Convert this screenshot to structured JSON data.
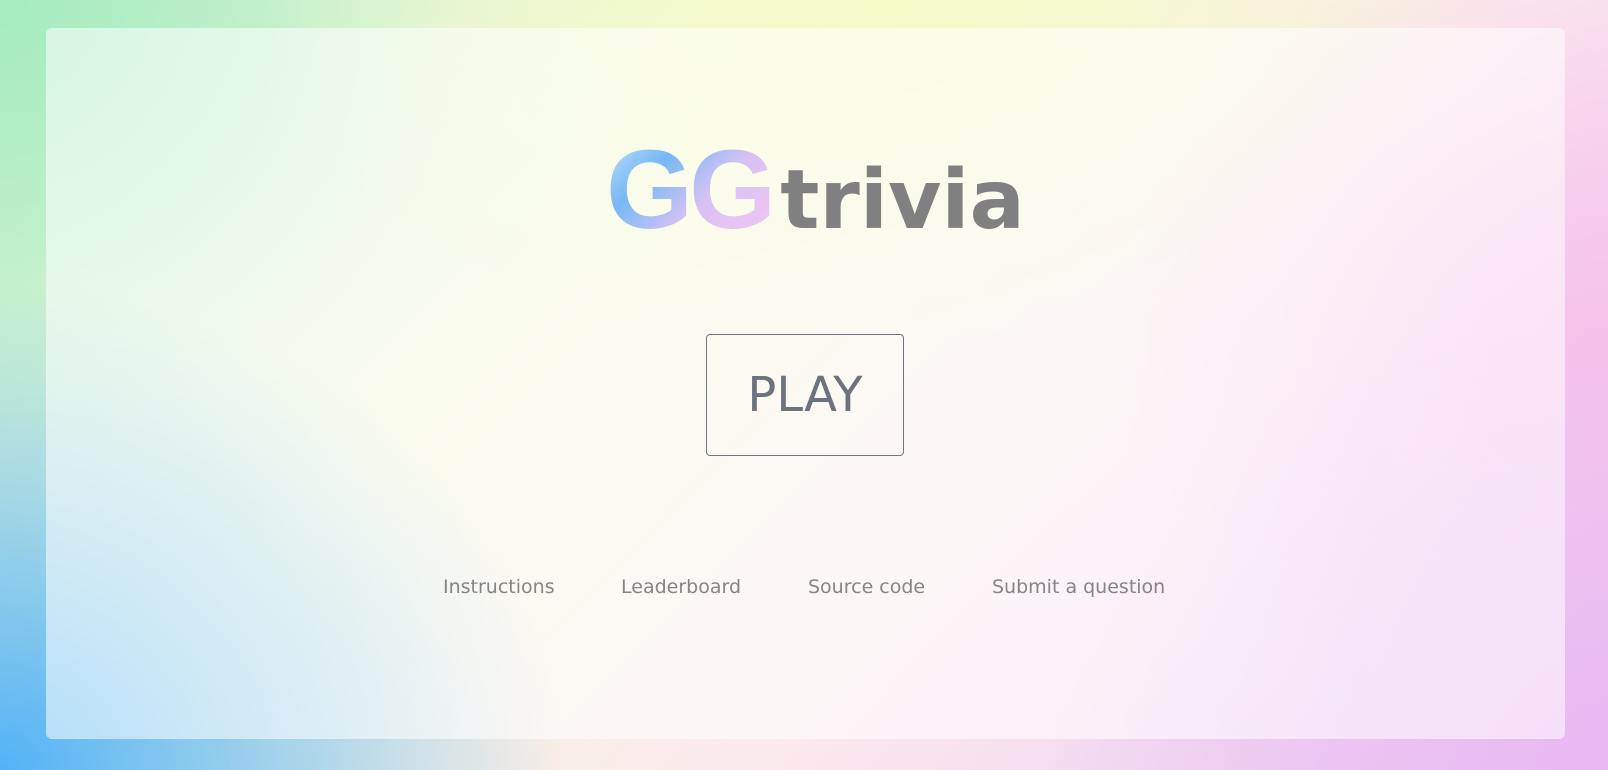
{
  "logo": {
    "gg_text": "GG",
    "trivia_text": "trivia"
  },
  "play_label": "PLAY",
  "nav": {
    "instructions": "Instructions",
    "leaderboard": "Leaderboard",
    "source_code": "Source code",
    "submit_question": "Submit a question"
  },
  "colors": {
    "text_gray": "#808080",
    "button_text": "#6c737c",
    "button_border": "#6f7680",
    "gradient_blue": "#52b2f7",
    "gradient_green": "#a5ecc0",
    "gradient_yellow": "#f6fbc8",
    "gradient_pink": "#f7c2ea"
  }
}
